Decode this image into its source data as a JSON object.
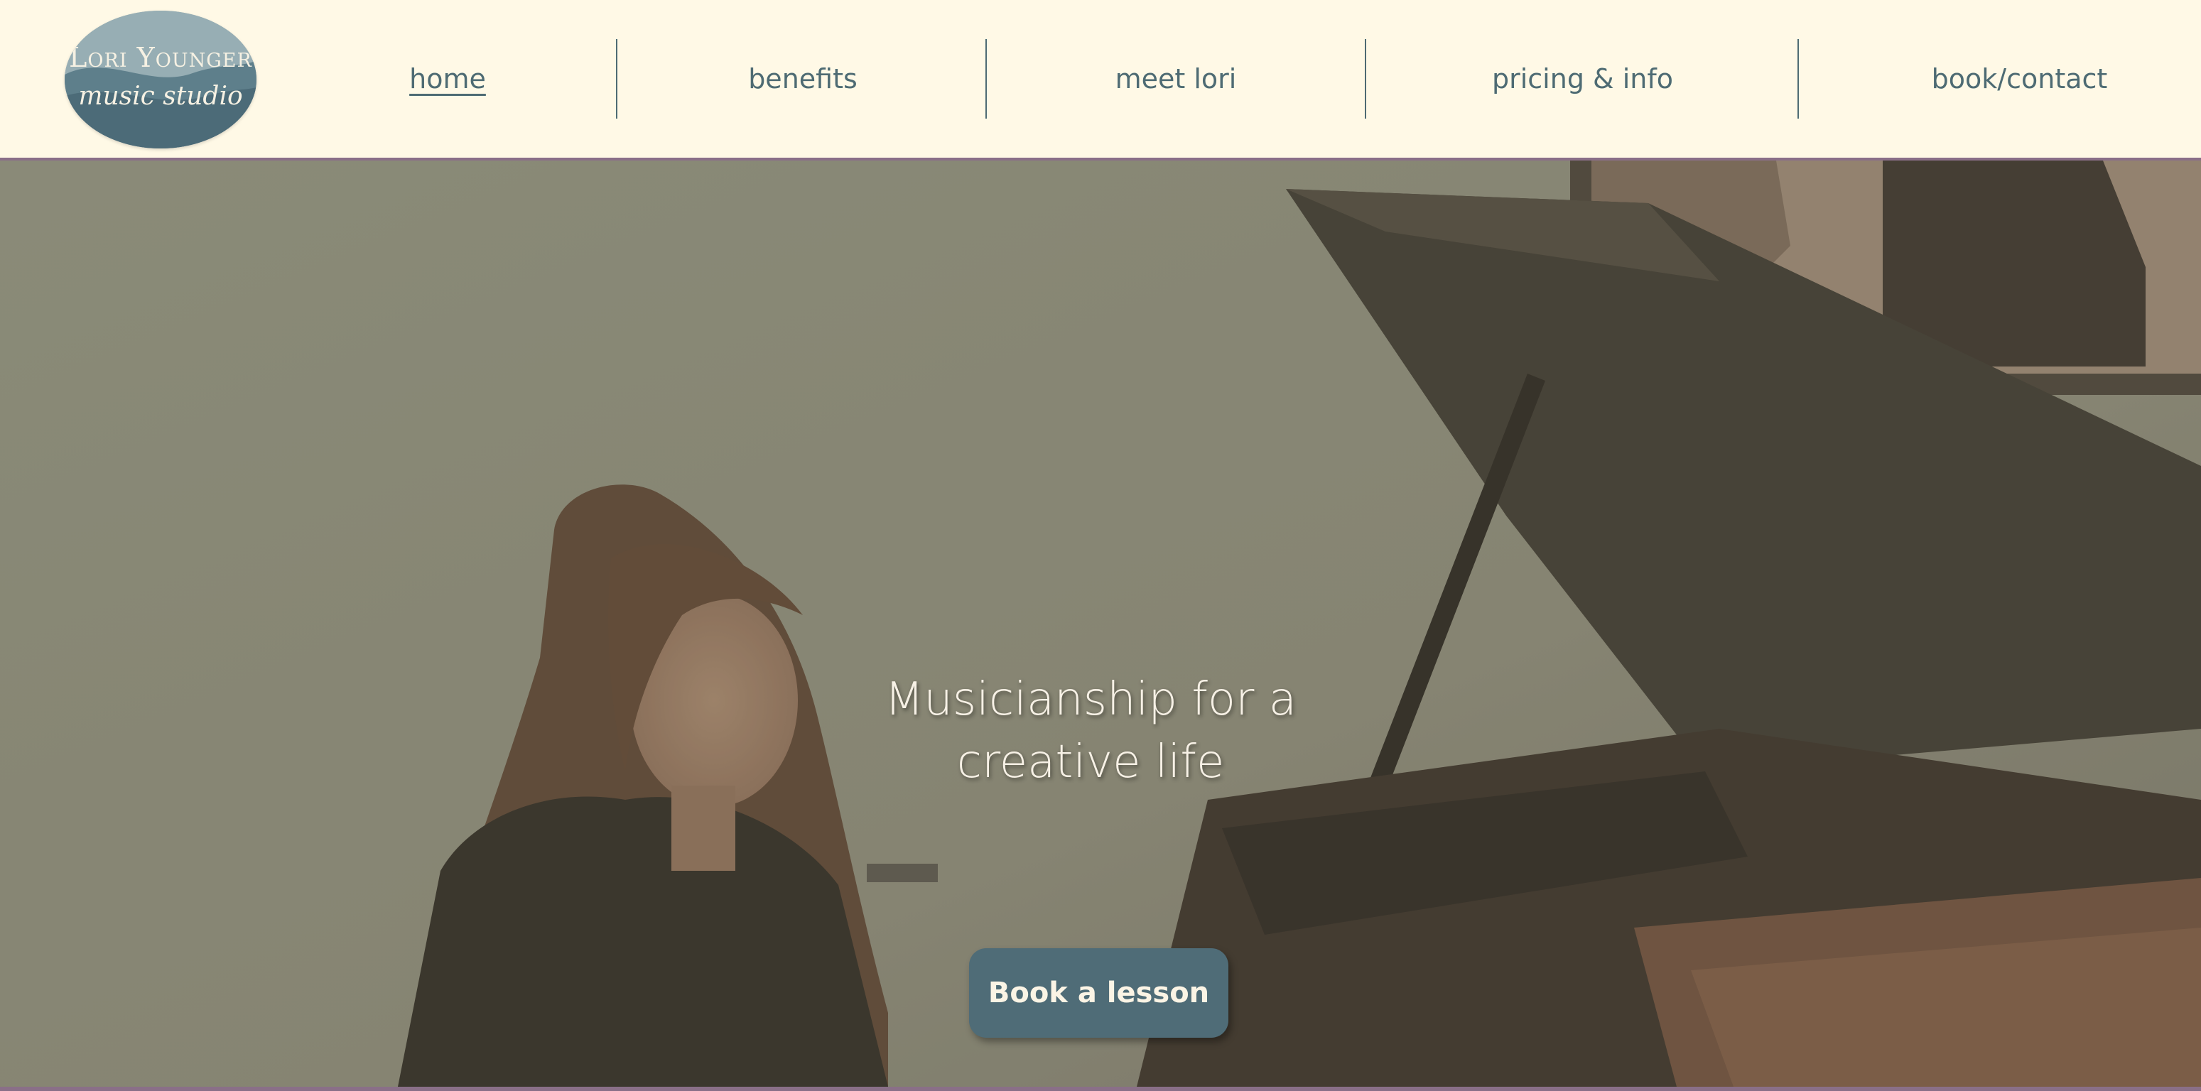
{
  "logo": {
    "line1": "Lori Younger",
    "line2": "music studio"
  },
  "nav": {
    "items": [
      {
        "label": "home",
        "active": true
      },
      {
        "label": "benefits",
        "active": false
      },
      {
        "label": "meet lori",
        "active": false
      },
      {
        "label": "pricing & info",
        "active": false
      },
      {
        "label": "book/contact",
        "active": false
      }
    ]
  },
  "hero": {
    "headline_line1": "Musicianship for a",
    "headline_line2": "creative life",
    "cta_label": "Book a lesson"
  },
  "colors": {
    "header_bg": "#fff9e6",
    "nav_text": "#4e6b73",
    "accent_border": "#8a6f88",
    "button_bg": "#4f6c77",
    "button_text": "#fbf4e5"
  }
}
